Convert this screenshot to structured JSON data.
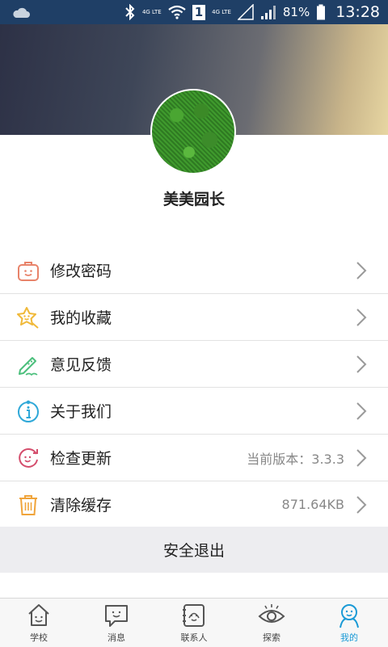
{
  "status_bar": {
    "network_small_1": "4G LTE",
    "sim_slot": "1",
    "network_small_2": "4G LTE",
    "battery_percent": "81%",
    "time": "13:28"
  },
  "profile": {
    "username": "美美园长"
  },
  "menu": [
    {
      "label": "修改密码",
      "icon": "briefcase-face-icon",
      "color": "#e8836a"
    },
    {
      "label": "我的收藏",
      "icon": "star-face-icon",
      "color": "#f0b93a"
    },
    {
      "label": "意见反馈",
      "icon": "pencil-face-icon",
      "color": "#4bbf7c"
    },
    {
      "label": "关于我们",
      "icon": "info-face-icon",
      "color": "#2fa8d8"
    },
    {
      "label": "检查更新",
      "icon": "refresh-face-icon",
      "color": "#d44d6c",
      "value": "当前版本：3.3.3"
    },
    {
      "label": "清除缓存",
      "icon": "trash-face-icon",
      "color": "#f0a43a",
      "value": "871.64KB"
    }
  ],
  "logout_label": "安全退出",
  "tabs": [
    {
      "label": "学校",
      "icon": "house-icon",
      "active": false
    },
    {
      "label": "消息",
      "icon": "chat-bubble-icon",
      "active": false
    },
    {
      "label": "联系人",
      "icon": "contact-face-icon",
      "active": false
    },
    {
      "label": "探索",
      "icon": "eye-icon",
      "active": false
    },
    {
      "label": "我的",
      "icon": "person-icon",
      "active": true
    }
  ],
  "colors": {
    "accent": "#1a9ad6",
    "status_bar": "#1f3f66",
    "tab_inactive": "#444444"
  }
}
